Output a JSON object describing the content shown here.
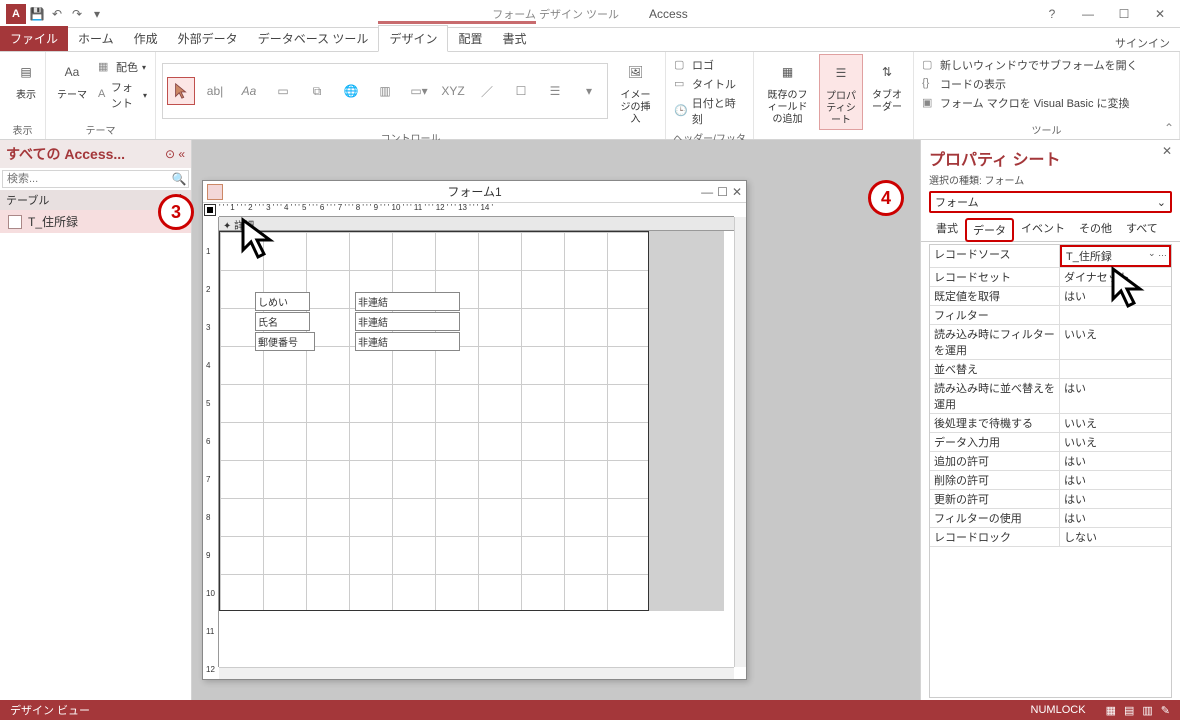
{
  "title": {
    "context_tool": "フォーム デザイン ツール",
    "app": "Access"
  },
  "signin": "サインイン",
  "tabs": {
    "file": "ファイル",
    "home": "ホーム",
    "create": "作成",
    "external": "外部データ",
    "dbtools": "データベース ツール",
    "design": "デザイン",
    "arrange": "配置",
    "format": "書式"
  },
  "ribbon": {
    "view": {
      "label": "表示",
      "group": "表示"
    },
    "themes": {
      "label": "テーマ",
      "colors": "配色",
      "fonts": "フォント",
      "group": "テーマ"
    },
    "controls_group": "コントロール",
    "image": {
      "label": "イメージの挿入"
    },
    "headerfooter": {
      "logo": "ロゴ",
      "title": "タイトル",
      "datetime": "日付と時刻",
      "group": "ヘッダー/フッター"
    },
    "addfields": "既存のフィールドの追加",
    "propsheet": "プロパティシート",
    "taborder": "タブオーダー",
    "tools": {
      "subform": "新しいウィンドウでサブフォームを開く",
      "viewcode": "コードの表示",
      "convertmacro": "フォーム マクロを Visual Basic に変換",
      "group": "ツール"
    }
  },
  "nav": {
    "title": "すべての Access...",
    "search_placeholder": "検索...",
    "group": "テーブル",
    "item1": "T_住所録"
  },
  "formwin": {
    "title": "フォーム1",
    "detail": "✦ 詳細",
    "labels": {
      "shimei": "しめい",
      "name": "氏名",
      "postal": "郵便番号"
    },
    "unbound": "非連結"
  },
  "propsheet": {
    "title": "プロパティ シート",
    "subtitle": "選択の種類: フォーム",
    "selector": "フォーム",
    "tabs": {
      "format": "書式",
      "data": "データ",
      "event": "イベント",
      "other": "その他",
      "all": "すべて"
    },
    "rows": [
      {
        "k": "レコードソース",
        "v": "T_住所録",
        "hl": true,
        "dd": true
      },
      {
        "k": "レコードセット",
        "v": "ダイナセット"
      },
      {
        "k": "既定値を取得",
        "v": "はい"
      },
      {
        "k": "フィルター",
        "v": ""
      },
      {
        "k": "読み込み時にフィルターを運用",
        "v": "いいえ"
      },
      {
        "k": "並べ替え",
        "v": ""
      },
      {
        "k": "読み込み時に並べ替えを運用",
        "v": "はい"
      },
      {
        "k": "後処理まで待機する",
        "v": "いいえ"
      },
      {
        "k": "データ入力用",
        "v": "いいえ"
      },
      {
        "k": "追加の許可",
        "v": "はい"
      },
      {
        "k": "削除の許可",
        "v": "はい"
      },
      {
        "k": "更新の許可",
        "v": "はい"
      },
      {
        "k": "フィルターの使用",
        "v": "はい"
      },
      {
        "k": "レコードロック",
        "v": "しない"
      }
    ]
  },
  "status": {
    "left": "デザイン ビュー",
    "numlock": "NUMLOCK"
  },
  "annotations": {
    "n3": "3",
    "n4": "4"
  }
}
